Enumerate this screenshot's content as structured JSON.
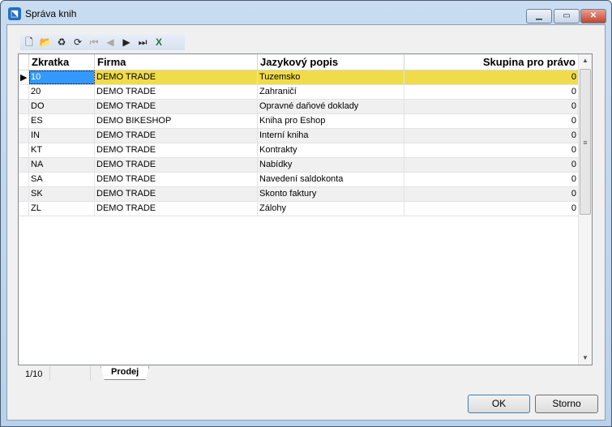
{
  "window": {
    "title": "Správa knih"
  },
  "grid": {
    "columns": [
      "Zkratka",
      "Firma",
      "Jazykový popis",
      "Skupina pro právo"
    ],
    "rows": [
      [
        "10",
        "DEMO TRADE",
        "Tuzemsko",
        "0"
      ],
      [
        "20",
        "DEMO TRADE",
        "Zahraničí",
        "0"
      ],
      [
        "DO",
        "DEMO TRADE",
        "Opravné daňové doklady",
        "0"
      ],
      [
        "ES",
        "DEMO BIKESHOP",
        "Kniha pro Eshop",
        "0"
      ],
      [
        "IN",
        "DEMO TRADE",
        "Interní kniha",
        "0"
      ],
      [
        "KT",
        "DEMO TRADE",
        "Kontrakty",
        "0"
      ],
      [
        "NA",
        "DEMO TRADE",
        "Nabídky",
        "0"
      ],
      [
        "SA",
        "DEMO TRADE",
        "Navedení saldokonta",
        "0"
      ],
      [
        "SK",
        "DEMO TRADE",
        "Skonto faktury",
        "0"
      ],
      [
        "ZL",
        "DEMO TRADE",
        "Zálohy",
        "0"
      ]
    ]
  },
  "status": {
    "position": "1/10",
    "tab": "Prodej"
  },
  "buttons": {
    "ok": "OK",
    "cancel": "Storno"
  },
  "colors": {
    "selected_row": "#f0dc4a",
    "selected_cell": "#3399ff"
  }
}
